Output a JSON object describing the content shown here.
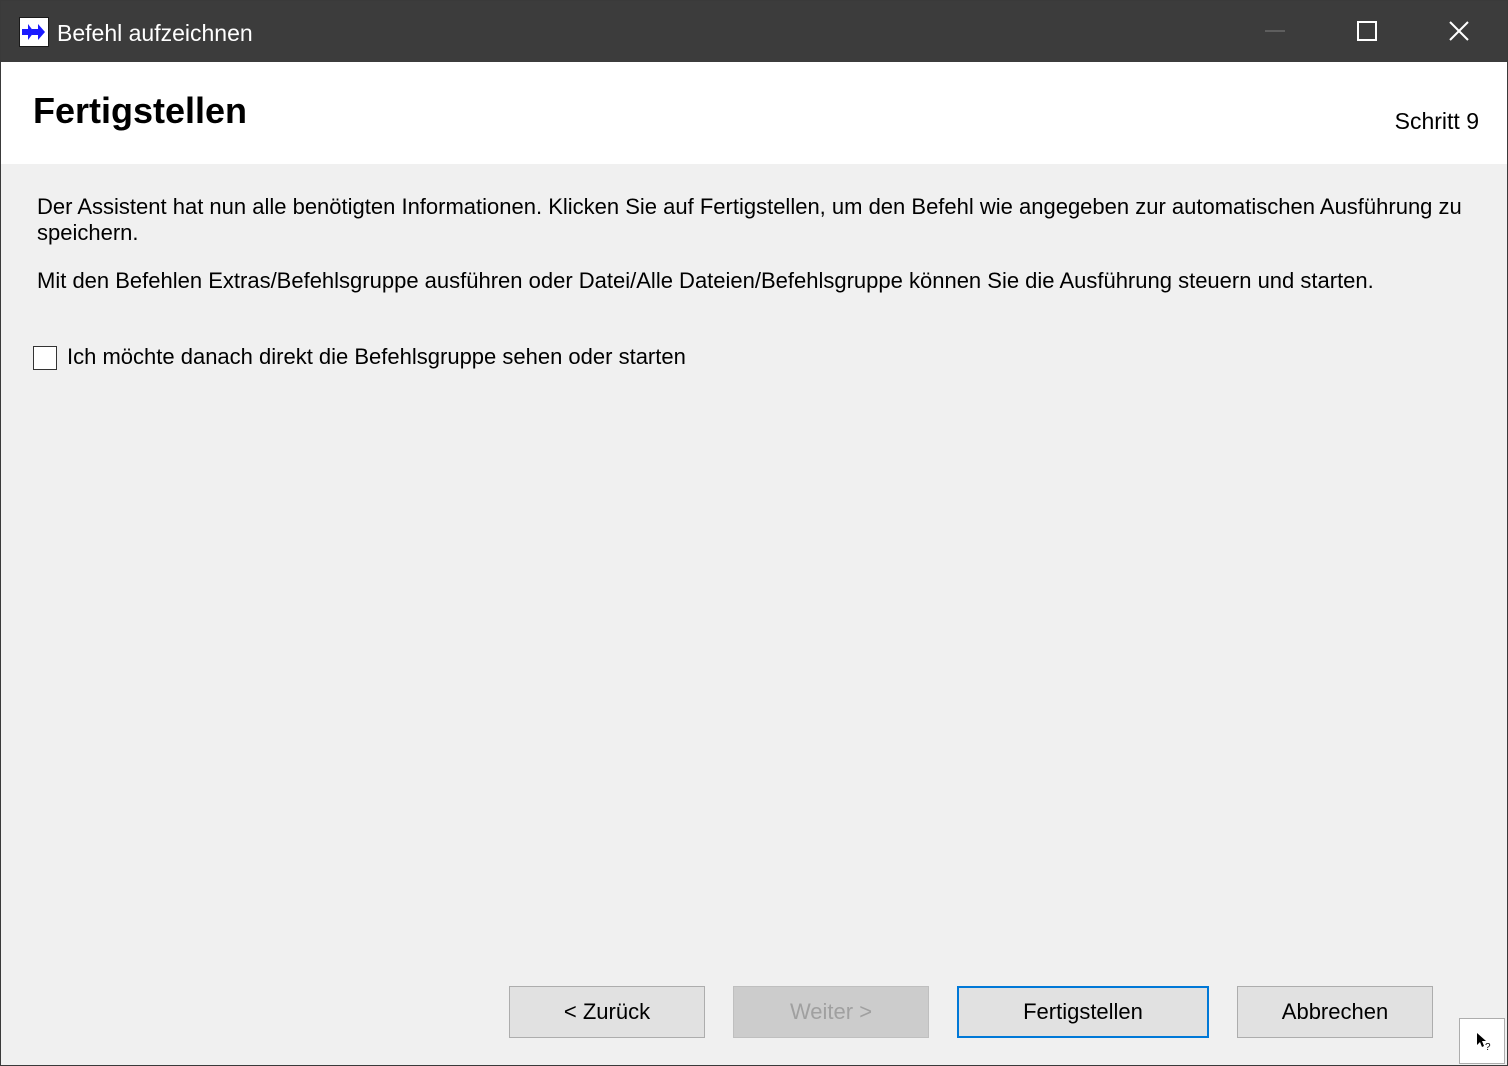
{
  "window": {
    "title": "Befehl aufzeichnen",
    "app_icon": "double-arrow-icon",
    "controls": [
      "minimize-icon",
      "maximize-icon",
      "close-icon"
    ]
  },
  "header": {
    "title": "Fertigstellen",
    "step": "Schritt 9"
  },
  "content": {
    "paragraph1": "Der Assistent hat nun alle benötigten Informationen. Klicken Sie auf Fertigstellen, um den Befehl wie angegeben zur automatischen Ausführung zu speichern.",
    "paragraph2": "Mit den Befehlen Extras/Befehlsgruppe ausführen oder Datei/Alle Dateien/Befehlsgruppe können Sie die Ausführung steuern und starten.",
    "checkbox": {
      "label": "Ich möchte danach direkt die Befehlsgruppe sehen oder starten",
      "checked": false
    }
  },
  "buttons": {
    "back": "< Zurück",
    "next": "Weiter >",
    "finish": "Fertigstellen",
    "cancel": "Abbrechen"
  },
  "colors": {
    "titlebar": "#3c3c3c",
    "focus_border": "#0078d7",
    "icon_blue": "#1a1aff"
  }
}
